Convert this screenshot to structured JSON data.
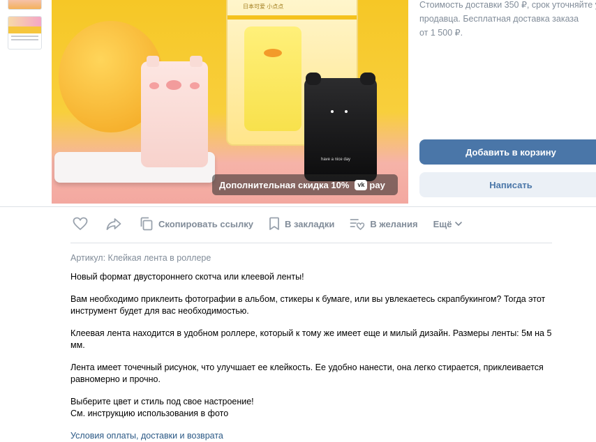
{
  "delivery": {
    "line1": "Стоимость доставки 350 ₽, срок уточняйте у",
    "line2": "продавца. Бесплатная доставка заказа",
    "line3": "от 1 500 ₽."
  },
  "promo": {
    "text": "Дополнительная скидка 10%",
    "vk_label": "vk",
    "pay_label": "pay"
  },
  "buttons": {
    "add_to_cart": "Добавить в корзину",
    "message": "Написать"
  },
  "actions": {
    "copy_link": "Скопировать ссылку",
    "bookmarks": "В закладки",
    "wishlist": "В желания",
    "more": "Ещё"
  },
  "description": {
    "sku": "Артикул: Клейкая лента в роллере",
    "p1": "Новый формат двустороннего скотча или клеевой ленты!",
    "p2": "Вам необходимо приклеить фотографии в альбом, стикеры к бумаге, или вы увлекаетесь скрапбукингом? Тогда этот инструмент будет для вас необходимостью.",
    "p3": "Клеевая лента находится в удобном роллере, который к тому же имеет еще и милый дизайн. Размеры ленты: 5м на 5 мм.",
    "p4": "Лента имеет точечный рисунок, что улучшает ее клейкость. Ее удобно нанести, она легко стирается, приклеивается равномерно и прочно.",
    "p5a": "Выберите цвет и стиль под свое настроение!",
    "p5b": "См. инструкцию использования в фото",
    "terms_link": "Условия оплаты, доставки и возврата"
  },
  "photo": {
    "card_text": "日本可爱 小点点",
    "bear_text": "have a nice day"
  },
  "colors": {
    "accent": "#4a76a8",
    "link": "#2a5885",
    "muted": "#818c99",
    "divider": "#dce1e6"
  }
}
